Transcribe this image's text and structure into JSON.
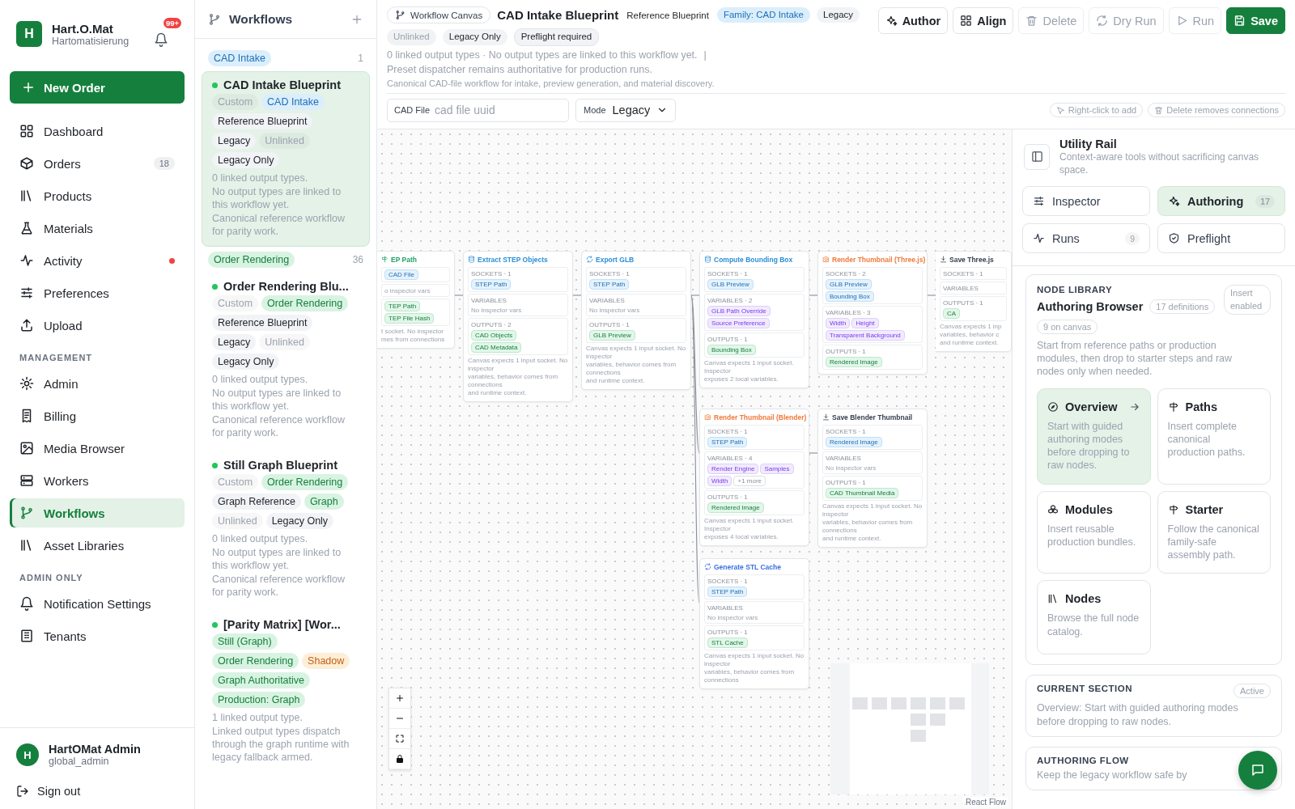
{
  "brand": {
    "initial": "H",
    "name": "Hart.O.Mat",
    "tagline": "Hartomatisierung",
    "notifications": "99+"
  },
  "new_order": "New Order",
  "nav_groups": [
    {
      "items": [
        {
          "label": "Dashboard",
          "selected": false,
          "alert": false
        },
        {
          "label": "Orders",
          "count": "18",
          "selected": false,
          "alert": false
        },
        {
          "label": "Products",
          "selected": false,
          "alert": false
        },
        {
          "label": "Materials",
          "selected": false,
          "alert": false
        },
        {
          "label": "Activity",
          "selected": false,
          "alert": true
        },
        {
          "label": "Preferences",
          "selected": false,
          "alert": false
        },
        {
          "label": "Upload",
          "selected": false,
          "alert": false
        }
      ]
    },
    {
      "heading": "MANAGEMENT",
      "items": [
        {
          "label": "Admin",
          "selected": false,
          "alert": false
        },
        {
          "label": "Billing",
          "selected": false,
          "alert": false
        },
        {
          "label": "Media Browser",
          "selected": false,
          "alert": false
        },
        {
          "label": "Workers",
          "selected": false,
          "alert": false
        },
        {
          "label": "Workflows",
          "selected": true,
          "alert": false
        },
        {
          "label": "Asset Libraries",
          "selected": false,
          "alert": false
        }
      ]
    },
    {
      "heading": "ADMIN ONLY",
      "items": [
        {
          "label": "Notification Settings",
          "selected": false,
          "alert": false
        },
        {
          "label": "Tenants",
          "selected": false,
          "alert": false
        }
      ]
    }
  ],
  "user": {
    "initial": "H",
    "name": "HartOMat Admin",
    "role": "global_admin"
  },
  "sign_out": "Sign out",
  "workflows": {
    "title": "Workflows",
    "groups": [
      {
        "tag": "CAD Intake",
        "kind": "blue",
        "count": "1",
        "items": [
          {
            "name": "CAD Intake Blueprint",
            "selected": true,
            "chips": [
              {
                "text": "Custom",
                "kind": "muted"
              },
              {
                "text": "CAD Intake",
                "kind": "blue"
              },
              {
                "text": "Reference Blueprint",
                "kind": "plain"
              },
              {
                "text": "Legacy",
                "kind": "plain"
              },
              {
                "text": "Unlinked",
                "kind": "muted"
              },
              {
                "text": "Legacy Only",
                "kind": "plain"
              }
            ],
            "linked": "0 linked output types.",
            "notes": [
              "No output types are linked to this workflow yet.",
              "Canonical reference workflow for parity work."
            ]
          }
        ]
      },
      {
        "tag": "Order Rendering",
        "kind": "green",
        "count": "36",
        "items": [
          {
            "name": "Order Rendering Blu...",
            "selected": false,
            "chips": [
              {
                "text": "Custom",
                "kind": "muted"
              },
              {
                "text": "Order Rendering",
                "kind": "green"
              },
              {
                "text": "Reference Blueprint",
                "kind": "plain"
              },
              {
                "text": "Legacy",
                "kind": "plain"
              },
              {
                "text": "Unlinked",
                "kind": "muted"
              },
              {
                "text": "Legacy Only",
                "kind": "plain"
              }
            ],
            "linked": "0 linked output types.",
            "notes": [
              "No output types are linked to this workflow yet.",
              "Canonical reference workflow for parity work."
            ]
          },
          {
            "name": "Still Graph Blueprint",
            "selected": false,
            "chips": [
              {
                "text": "Custom",
                "kind": "muted"
              },
              {
                "text": "Order Rendering",
                "kind": "green"
              },
              {
                "text": "Graph Reference",
                "kind": "plain"
              },
              {
                "text": "Graph",
                "kind": "green"
              },
              {
                "text": "Unlinked",
                "kind": "muted"
              },
              {
                "text": "Legacy Only",
                "kind": "plain"
              }
            ],
            "linked": "0 linked output types.",
            "notes": [
              "No output types are linked to this workflow yet.",
              "Canonical reference workflow for parity work."
            ]
          },
          {
            "name": "[Parity Matrix] [Wor...",
            "selected": false,
            "chips": [
              {
                "text": "Still (Graph)",
                "kind": "green"
              },
              {
                "text": "Order Rendering",
                "kind": "green"
              },
              {
                "text": "Shadow",
                "kind": "orange"
              },
              {
                "text": "Graph Authoritative",
                "kind": "green"
              },
              {
                "text": "Production: Graph",
                "kind": "green"
              }
            ],
            "linked": "1 linked output type.",
            "notes": [
              "Linked output types dispatch through the graph runtime with legacy fallback armed."
            ]
          }
        ]
      }
    ]
  },
  "header": {
    "badge": "Workflow Canvas",
    "title": "CAD Intake Blueprint",
    "subtitle": "Reference Blueprint",
    "tags": [
      {
        "text": "Family: CAD Intake",
        "kind": "blue"
      },
      {
        "text": "Legacy",
        "kind": "plain"
      }
    ],
    "flags": [
      {
        "text": "Unlinked",
        "kind": "muted"
      },
      {
        "text": "Legacy Only",
        "kind": "plain"
      },
      {
        "text": "Preflight required",
        "kind": "outline"
      }
    ],
    "summary": "0 linked output types · No output types are linked to this workflow yet.",
    "separator": "|",
    "dispatch": "Preset dispatcher remains authoritative for production runs.",
    "description": "Canonical CAD-file workflow for intake, preview generation, and material discovery."
  },
  "actions": [
    {
      "label": "Author",
      "kind": "outline",
      "disabled": false
    },
    {
      "label": "Align",
      "kind": "outline",
      "disabled": false
    },
    {
      "label": "Delete",
      "kind": "outline",
      "disabled": true
    },
    {
      "label": "Dry Run",
      "kind": "outline",
      "disabled": true
    },
    {
      "label": "Run",
      "kind": "outline",
      "disabled": true
    },
    {
      "label": "Save",
      "kind": "primary",
      "disabled": false
    }
  ],
  "cad_file": {
    "label": "CAD File",
    "placeholder": "cad file uuid"
  },
  "mode": {
    "label": "Mode",
    "value": "Legacy"
  },
  "hints": [
    "Right-click to add",
    "Delete removes connections"
  ],
  "nodes": [
    {
      "title": "EP Path",
      "color": "#22a06b",
      "sections": [
        {
          "chips": [
            {
              "text": "CAD File",
              "kind": "socket"
            }
          ]
        },
        {
          "empty": "o inspector vars"
        },
        {
          "chips": [
            {
              "text": "TEP Path",
              "kind": "output"
            },
            {
              "text": "TEP File Hash",
              "kind": "output"
            }
          ]
        }
      ],
      "note": [
        "t socket. No inspector",
        "mes from connections"
      ]
    },
    {
      "title": "Extract STEP Objects",
      "color": "#2b8fd6",
      "sections": [
        {
          "label": "SOCKETS · 1",
          "chips": [
            {
              "text": "STEP Path",
              "kind": "socket"
            }
          ]
        },
        {
          "label": "VARIABLES",
          "empty": "No inspector vars"
        },
        {
          "label": "OUTPUTS · 2",
          "chips": [
            {
              "text": "CAD Objects",
              "kind": "output"
            },
            {
              "text": "CAD Metadata",
              "kind": "output"
            }
          ]
        }
      ],
      "note": [
        "Canvas expects 1 input socket. No inspector",
        "variables, behavior comes from connections",
        "and runtime context."
      ]
    },
    {
      "title": "Export GLB",
      "color": "#2b8fd6",
      "sections": [
        {
          "label": "SOCKETS · 1",
          "chips": [
            {
              "text": "STEP Path",
              "kind": "socket"
            }
          ]
        },
        {
          "label": "VARIABLES",
          "empty": "No inspector vars"
        },
        {
          "label": "OUTPUTS · 1",
          "chips": [
            {
              "text": "GLB Preview",
              "kind": "output"
            }
          ]
        }
      ],
      "note": [
        "Canvas expects 1 input socket. No inspector",
        "variables, behavior comes from connections",
        "and runtime context."
      ]
    },
    {
      "title": "Compute Bounding Box",
      "color": "#2b8fd6",
      "sections": [
        {
          "label": "SOCKETS · 1",
          "chips": [
            {
              "text": "GLB Preview",
              "kind": "socket"
            }
          ]
        },
        {
          "label": "VARIABLES · 2",
          "chips": [
            {
              "text": "GLB Path Override",
              "kind": "variable"
            },
            {
              "text": "Source Preference",
              "kind": "variable"
            }
          ]
        },
        {
          "label": "OUTPUTS · 1",
          "chips": [
            {
              "text": "Bounding Box",
              "kind": "output"
            }
          ]
        }
      ],
      "note": [
        "Canvas expects 1 input socket. Inspector",
        "exposes 2 local variables."
      ]
    },
    {
      "title": "Render Thumbnail (Three.js)",
      "color": "#f07a3a",
      "sections": [
        {
          "label": "SOCKETS · 2",
          "chips": [
            {
              "text": "GLB Preview",
              "kind": "socket"
            },
            {
              "text": "Bounding Box",
              "kind": "socket"
            }
          ]
        },
        {
          "label": "VARIABLES · 3",
          "chips": [
            {
              "text": "Width",
              "kind": "variable"
            },
            {
              "text": "Height",
              "kind": "variable"
            },
            {
              "text": "Transparent Background",
              "kind": "variable"
            }
          ]
        },
        {
          "label": "OUTPUTS · 1",
          "chips": [
            {
              "text": "Rendered Image",
              "kind": "output"
            }
          ]
        }
      ]
    },
    {
      "title": "Save Three.js",
      "color": "#374151",
      "sections": [
        {
          "label": "SOCKETS · 1"
        },
        {
          "label": "VARIABLES"
        },
        {
          "label": "OUTPUTS · 1",
          "chips": [
            {
              "text": "CA",
              "kind": "output"
            }
          ]
        }
      ],
      "note": [
        "Canvas expects 1 inp",
        "variables, behavior c",
        "and runtime context."
      ]
    },
    {
      "title": "Render Thumbnail (Blender)",
      "color": "#f07a3a",
      "sections": [
        {
          "label": "SOCKETS · 1",
          "chips": [
            {
              "text": "STEP Path",
              "kind": "socket"
            }
          ]
        },
        {
          "label": "VARIABLES · 4",
          "chips": [
            {
              "text": "Render Engine",
              "kind": "variable"
            },
            {
              "text": "Samples",
              "kind": "variable"
            },
            {
              "text": "Width",
              "kind": "variable"
            },
            {
              "text": "+1 more",
              "kind": "more"
            }
          ]
        },
        {
          "label": "OUTPUTS · 1",
          "chips": [
            {
              "text": "Rendered Image",
              "kind": "output"
            }
          ]
        }
      ],
      "note": [
        "Canvas expects 1 input socket. Inspector",
        "exposes 4 local variables."
      ]
    },
    {
      "title": "Save Blender Thumbnail",
      "color": "#374151",
      "sections": [
        {
          "label": "SOCKETS · 1",
          "chips": [
            {
              "text": "Rendered Image",
              "kind": "socket"
            }
          ]
        },
        {
          "label": "VARIABLES",
          "empty": "No inspector vars"
        },
        {
          "label": "OUTPUTS · 1",
          "chips": [
            {
              "text": "CAD Thumbnail Media",
              "kind": "output"
            }
          ]
        }
      ],
      "note": [
        "Canvas expects 1 input socket. No inspector",
        "variables, behavior comes from connections",
        "and runtime context."
      ]
    },
    {
      "title": "Generate STL Cache",
      "color": "#3b6fe0",
      "sections": [
        {
          "label": "SOCKETS · 1",
          "chips": [
            {
              "text": "STEP Path",
              "kind": "socket"
            }
          ]
        },
        {
          "label": "VARIABLES",
          "empty": "No inspector vars"
        },
        {
          "label": "OUTPUTS · 1",
          "chips": [
            {
              "text": "STL Cache",
              "kind": "output"
            }
          ]
        }
      ],
      "note": [
        "Canvas expects 1 input socket. No inspector",
        "variables, behavior comes from connections"
      ]
    }
  ],
  "attribution": "React Flow",
  "rail": {
    "title": "Utility Rail",
    "subtitle": "Context-aware tools without sacrificing canvas space.",
    "tabs": [
      {
        "label": "Inspector",
        "selected": false
      },
      {
        "label": "Authoring",
        "count": "17",
        "selected": true
      },
      {
        "label": "Runs",
        "count": "9",
        "selected": false
      },
      {
        "label": "Preflight",
        "selected": false
      }
    ],
    "library": {
      "eyebrow": "NODE LIBRARY",
      "title": "Authoring Browser",
      "count": "17 definitions",
      "status": "Insert enabled",
      "on_canvas": "9 on canvas",
      "description": "Start from reference paths or production modules, then drop to starter steps and raw nodes only when needed.",
      "sections": [
        {
          "title": "Overview",
          "text": "Start with guided authoring modes before dropping to raw nodes.",
          "selected": true
        },
        {
          "title": "Paths",
          "text": "Insert complete canonical production paths.",
          "selected": false
        },
        {
          "title": "Modules",
          "text": "Insert reusable production bundles.",
          "selected": false
        },
        {
          "title": "Starter",
          "text": "Follow the canonical family-safe assembly path.",
          "selected": false
        },
        {
          "title": "Nodes",
          "text": "Browse the full node catalog.",
          "selected": false
        }
      ]
    },
    "current": {
      "eyebrow": "CURRENT SECTION",
      "status": "Active",
      "text": "Overview: Start with guided authoring modes before dropping to raw nodes."
    },
    "flow": {
      "eyebrow": "AUTHORING FLOW",
      "text": "Keep the legacy workflow safe by"
    }
  }
}
